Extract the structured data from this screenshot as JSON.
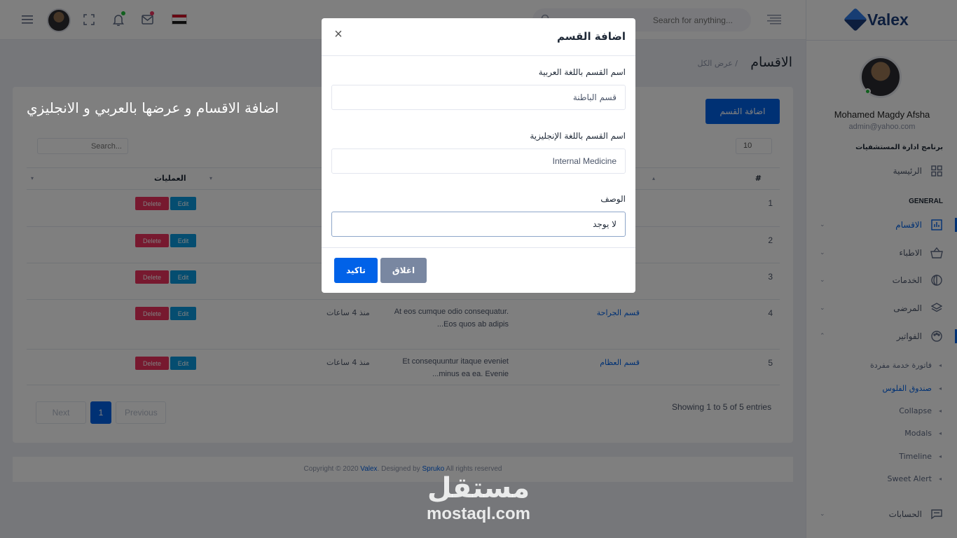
{
  "header": {
    "search_placeholder": "Search for anything...",
    "flag_colors": [
      "#ce1126",
      "#ffffff",
      "#1a1a1a"
    ],
    "notification_dot_color": "#22c03c",
    "mail_dot_color": "#ee335e"
  },
  "sidebar": {
    "brand": "Valex",
    "user_name": "Mohamed Magdy Afsha",
    "user_email": "admin@yahoo.com",
    "program_title": "برنامج ادارة المستشفيات",
    "home_label": "الرئيسية",
    "section_label": "GENERAL",
    "items": [
      {
        "label": "الاقسام",
        "icon": "chart-bar-icon",
        "active": true
      },
      {
        "label": "الاطباء",
        "icon": "basket-icon",
        "active": false
      },
      {
        "label": "الخدمات",
        "icon": "globe-icon",
        "active": false
      },
      {
        "label": "المرضى",
        "icon": "layers-icon",
        "active": false
      },
      {
        "label": "الفواتير",
        "icon": "palette-icon",
        "active": false
      }
    ],
    "subitems": [
      {
        "label": "فاتورة خدمة مفردة",
        "active": false
      },
      {
        "label": "صندوق الفلوس",
        "active": true
      },
      {
        "label": "Collapse",
        "active": false
      },
      {
        "label": "Modals",
        "active": false
      },
      {
        "label": "Timeline",
        "active": false
      },
      {
        "label": "Sweet Alert",
        "active": false
      }
    ],
    "accounts_label": "الحسابات"
  },
  "page": {
    "title": "الاقسام",
    "breadcrumb": "/ عرض الكل",
    "overlay_heading": "اضافة الاقسام و عرضها بالعربي و الانجليزي",
    "add_button": "اضافة القسم",
    "length_value": "10",
    "search_placeholder": "Search...",
    "columns": {
      "num": "#",
      "ops": "العمليات"
    },
    "delete_label": "Delete",
    "edit_label": "Edit",
    "rows": [
      {
        "num": "1",
        "name": "",
        "desc": "",
        "time": ""
      },
      {
        "num": "2",
        "name": "",
        "desc": "",
        "time": ""
      },
      {
        "num": "3",
        "name": "",
        "desc": "",
        "time": ""
      },
      {
        "num": "4",
        "name": "قسم الجراحة",
        "desc": "At eos cumque odio consequatur. Eos quos ab adipis...",
        "time": "منذ 4 ساعات"
      },
      {
        "num": "5",
        "name": "قسم العظام",
        "desc": "Et consequuntur itaque eveniet minus ea ea. Evenie...",
        "time": "منذ 4 ساعات"
      }
    ],
    "showing": "Showing 1 to 5 of 5 entries",
    "pager": {
      "next": "Next",
      "current": "1",
      "previous": "Previous"
    }
  },
  "footer": {
    "prefix": "Copyright © 2020 ",
    "brand": "Valex",
    "mid": ". Designed by ",
    "designer": "Spruko",
    "suffix": " All rights reserved"
  },
  "watermark": {
    "arabic": "مستقل",
    "latin": "mostaql.com"
  },
  "modal": {
    "title": "اضافة القسم",
    "close_symbol": "×",
    "label_ar": "اسم القسم باللغة العربية",
    "value_ar": "قسم الباطنة",
    "label_en": "اسم القسم باللغة الإنجليزية",
    "value_en": "Internal Medicine",
    "label_desc": "الوصف",
    "value_desc": "لا يوجد",
    "confirm_label": "تاكيد",
    "close_label": "اغلاق",
    "confirm_color": "#0162e8",
    "close_color": "#7987a1"
  }
}
